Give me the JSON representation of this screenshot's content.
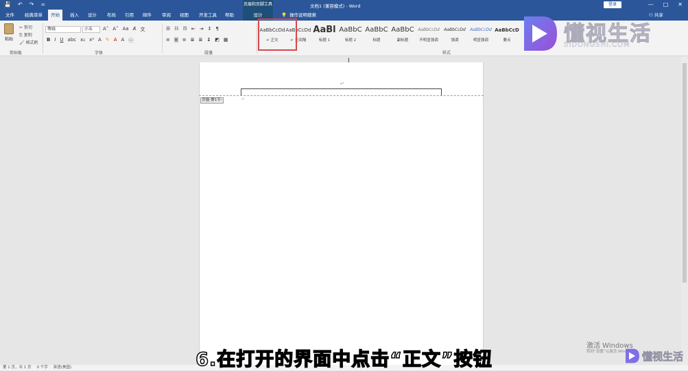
{
  "titlebar": {
    "context_tool": "页眉和页脚工具",
    "doc_title": "文档1 (兼容模式) - Word",
    "login": "登录",
    "quick_access": [
      "💾",
      "↶",
      "↷",
      "="
    ]
  },
  "tabs": {
    "items": [
      "文件",
      "经典菜单",
      "开始",
      "插入",
      "设计",
      "布局",
      "引用",
      "邮件",
      "审阅",
      "视图",
      "开发工具",
      "帮助"
    ],
    "context_tab": "设计",
    "tell_me": "操作说明搜索",
    "share": "共享"
  },
  "ribbon": {
    "paste_label": "粘贴",
    "cut": "剪切",
    "copy": "复制",
    "format_painter": "格式刷",
    "clipboard_label": "剪贴板",
    "font_name": "等线",
    "font_size": "小五",
    "font_label": "字体",
    "paragraph_label": "段落",
    "styles_label": "样式",
    "styles": [
      {
        "preview": "AaBbCcDd",
        "name": "↵ 正文"
      },
      {
        "preview": "AaBbCcDd",
        "name": "↵ 无间隔"
      },
      {
        "preview": "AaBl",
        "name": "标题 1"
      },
      {
        "preview": "AaBbC",
        "name": "标题 2"
      },
      {
        "preview": "AaBbC",
        "name": "标题"
      },
      {
        "preview": "AaBbC",
        "name": "副标题"
      },
      {
        "preview": "AaBbCcDd",
        "name": "不明显强调"
      },
      {
        "preview": "AaBbCcDd",
        "name": "强调"
      },
      {
        "preview": "AaBbCcDd",
        "name": "明显强调"
      },
      {
        "preview": "AaBbCcD",
        "name": "要点"
      }
    ]
  },
  "document": {
    "header_tag": "页眉-第1节-",
    "para_mark": "↵",
    "header_mark": "↵"
  },
  "statusbar": {
    "page": "第 1 页，共 1 页",
    "words": "0 个字",
    "lang": "英语(美国)"
  },
  "overlay": {
    "caption": "6.在打开的界面中点击“正文”按钮",
    "watermark_cn": "懂视生活",
    "watermark_en": "SIDONGSHI.COM",
    "watermark_small": "懂视生活",
    "win_activate": "激活 Windows",
    "win_activate_sub": "转到“设置”以激活 Windows。"
  },
  "colors": {
    "ribbon_blue": "#2b579a",
    "highlight_red": "#d9464c"
  }
}
